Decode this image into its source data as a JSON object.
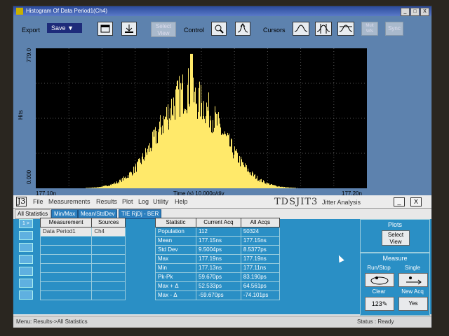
{
  "window": {
    "title": "Histogram Of Data Period1(Ch4)",
    "btn_min": "_",
    "btn_max": "□",
    "btn_close": "X"
  },
  "toolbar": {
    "export_label": "Export",
    "save_label": "Save ▼",
    "select_view_label": "Select View",
    "control_label": "Control",
    "cursors_label": "Cursors",
    "sync_label": "Sync",
    "multi_label": "Mult Wfs"
  },
  "plot": {
    "y_axis_title": "Hits",
    "y_max_label": "779.0",
    "y_min_label": "0.000",
    "x_min_label": "177.10n",
    "x_max_label": "177.20n",
    "x_axis_title": "Time (s)  10.000p/div",
    "bar_color": "#ffe96a"
  },
  "chart_data": {
    "type": "bar",
    "title": "Histogram Of Data Period1(Ch4)",
    "xlabel": "Time (s)  10.000p/div",
    "ylabel": "Hits",
    "xlim": [
      "177.10n",
      "177.20n"
    ],
    "ylim": [
      0,
      779.0
    ],
    "grid": true,
    "mean_ns": 177.15,
    "stddev_ps": 9.5004,
    "peak_hits": 779
  },
  "j3": {
    "logo": "J3",
    "menu": [
      "File",
      "Measurements",
      "Results",
      "Plot",
      "Log",
      "Utility",
      "Help"
    ],
    "brand": "TDSJIT3",
    "brand_sub": "Jitter Analysis",
    "btn_min": "_",
    "btn_close": "X",
    "tabs": [
      "All Statistics",
      "Min/Max",
      "Mean/StdDev",
      "TIE RjDj - BER"
    ],
    "side_buttons": [
      "1 >",
      "",
      "",
      "",
      "",
      "",
      ""
    ],
    "meas_headers": [
      "Measurement",
      "Sources"
    ],
    "meas_rows": [
      [
        "Data Period1",
        "Ch4"
      ]
    ],
    "stat_headers": [
      "Statistic",
      "Current Acq",
      "All Acqs"
    ],
    "stat_rows": [
      [
        "Population",
        "112",
        "50324"
      ],
      [
        "Mean",
        "177.15ns",
        "177.15ns"
      ],
      [
        "Std Dev",
        "9.5004ps",
        "8.5377ps"
      ],
      [
        "Max",
        "177.19ns",
        "177.19ns"
      ],
      [
        "Min",
        "177.13ns",
        "177.11ns"
      ],
      [
        "Pk-Pk",
        "59.670ps",
        "83.190ps"
      ],
      [
        "Max + Δ",
        "52.533ps",
        "64.561ps"
      ],
      [
        "Max - Δ",
        "-59.670ps",
        "-74.101ps"
      ]
    ],
    "plots_title": "Plots",
    "plots_select_view": "Select View",
    "measure_title": "Measure",
    "run_stop_label": "Run/Stop",
    "single_label": "Single",
    "clear_label": "Clear",
    "new_acq_label": "New Acq",
    "yes_label": "Yes",
    "clear_icon_text": "123",
    "status_left": "Menu: Results->All Statistics",
    "status_right": "Status : Ready"
  }
}
